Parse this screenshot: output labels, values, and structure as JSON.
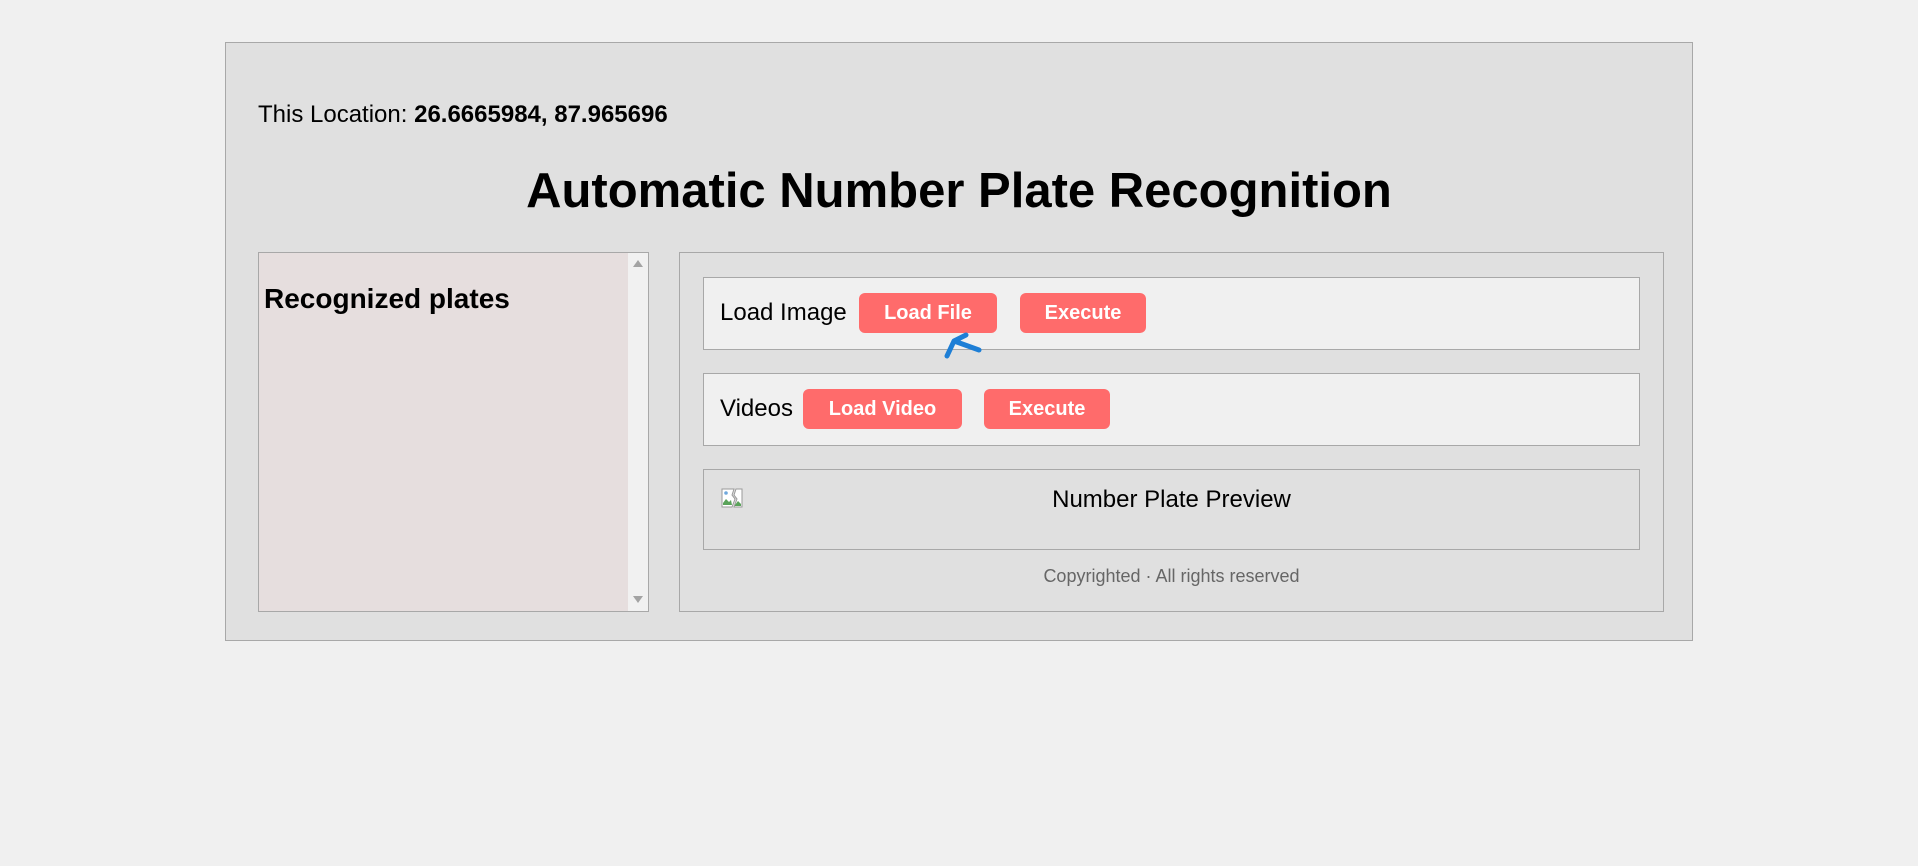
{
  "location": {
    "label": "This Location:",
    "coordinates": "26.6665984, 87.965696"
  },
  "page_title": "Automatic Number Plate Recognition",
  "plates_panel": {
    "heading": "Recognized plates"
  },
  "image_row": {
    "label": "Load Image",
    "load_button": "Load File",
    "execute_button": "Execute"
  },
  "video_row": {
    "label": "Videos",
    "load_button": "Load Video",
    "execute_button": "Execute"
  },
  "preview": {
    "alt_text": "Number Plate Preview",
    "icon": "broken-image-icon"
  },
  "footer": "Copyrighted · All rights reserved",
  "colors": {
    "button_bg": "#ff6b6b",
    "page_bg": "#f0f0f0",
    "panel_bg": "#e0e0e0",
    "plates_bg": "#e6dede",
    "cursor": "#1e7fd6"
  }
}
